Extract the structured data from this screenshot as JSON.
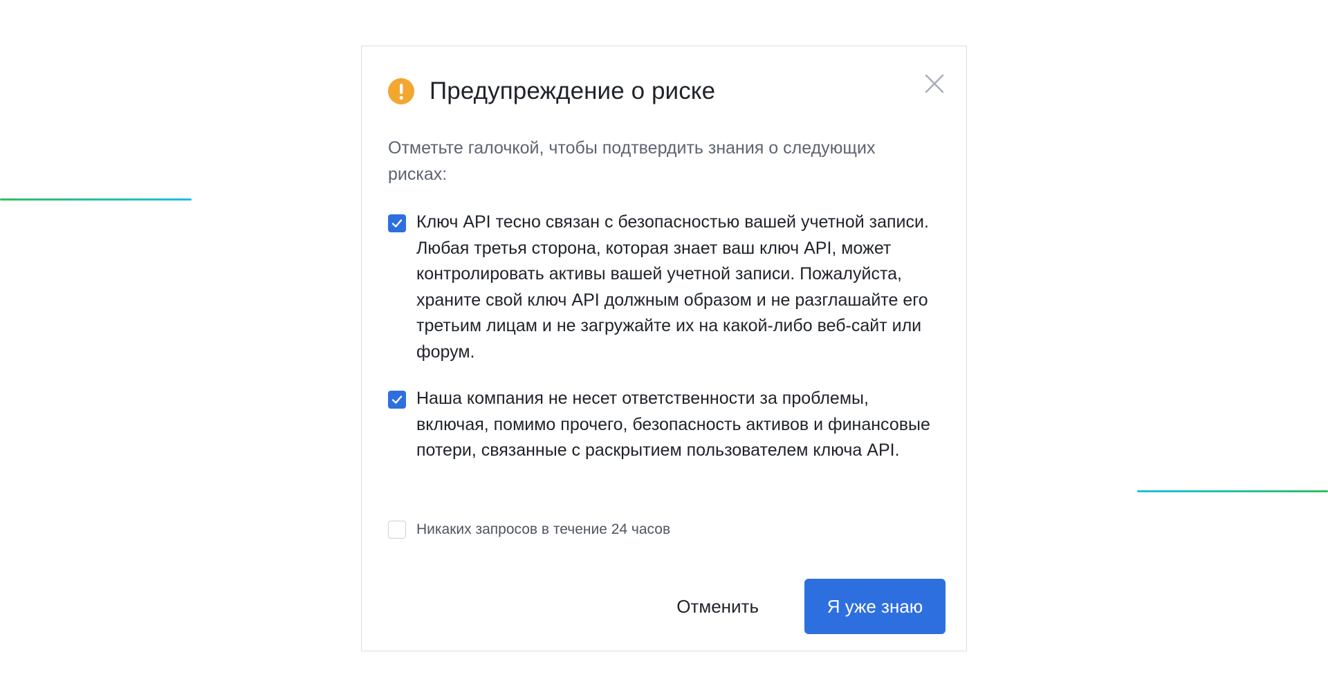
{
  "colors": {
    "primary": "#2e6fe0",
    "warning": "#f3a630",
    "accent_line_green": "#2fbf5d",
    "accent_line_cyan": "#1cc0e0"
  },
  "dialog": {
    "icon": "warning-exclamation-icon",
    "title": "Предупреждение о риске",
    "close_icon": "close-icon",
    "intro": "Отметьте галочкой, чтобы подтвердить знания о следующих рисках:",
    "items": [
      {
        "checked": true,
        "text": "Ключ API тесно связан с безопасностью вашей учетной записи. Любая третья сторона, которая знает ваш ключ API, может контролировать активы вашей учетной записи. Пожалуйста, храните свой ключ API должным образом и не разглашайте его третьим лицам и не загружайте их на какой-либо веб-сайт или форум."
      },
      {
        "checked": true,
        "text": "Наша компания не несет ответственности за проблемы, включая, помимо прочего, безопасность активов и финансовые потери, связанные с раскрытием пользователем ключа API."
      },
      {
        "checked": false,
        "text": "Никаких запросов в течение 24 часов"
      }
    ],
    "cancel_label": "Отменить",
    "confirm_label": "Я уже знаю"
  }
}
